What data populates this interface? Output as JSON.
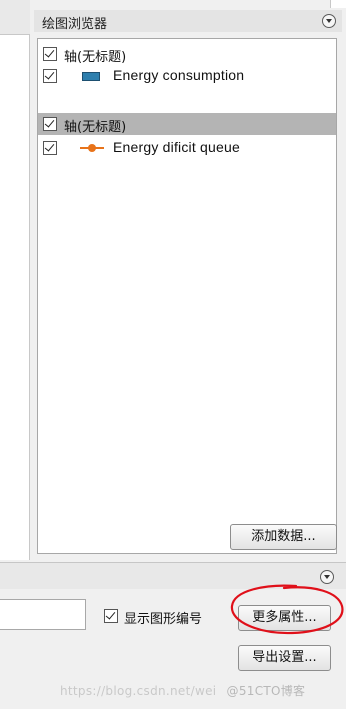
{
  "plot_browser": {
    "title": "绘图浏览器",
    "items": [
      {
        "label": "轴(无标题)",
        "checked": true,
        "selected": false,
        "kind": "axis"
      },
      {
        "label": "Energy consumption",
        "checked": true,
        "selected": false,
        "kind": "bar-series",
        "color": "#2e7fae"
      },
      {
        "label": "轴(无标题)",
        "checked": true,
        "selected": true,
        "kind": "axis"
      },
      {
        "label": "Energy dificit queue",
        "checked": true,
        "selected": false,
        "kind": "line-series",
        "color": "#e8731a"
      }
    ],
    "add_data_label": "添加数据..."
  },
  "bottom_panel": {
    "name_input_value": "",
    "show_figure_number": {
      "label": "显示图形编号",
      "checked": true
    },
    "more_properties_label": "更多属性...",
    "export_settings_label": "导出设置..."
  },
  "watermark": {
    "url": "https://blog.csdn.net/wei",
    "brand": "@51CTO博客"
  },
  "colors": {
    "selection": "#b4b4b4",
    "annotation": "#e0101a"
  }
}
